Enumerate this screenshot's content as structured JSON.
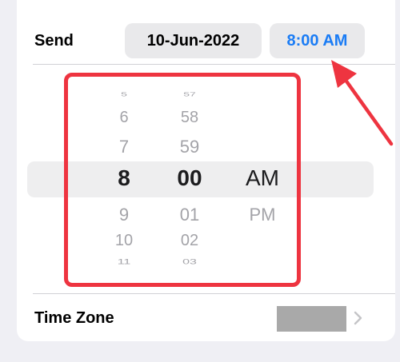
{
  "send": {
    "label": "Send",
    "date": "10-Jun-2022",
    "time": "8:00 AM"
  },
  "picker": {
    "hours": [
      "5",
      "6",
      "7",
      "8",
      "9",
      "10",
      "11"
    ],
    "minutes": [
      "57",
      "58",
      "59",
      "00",
      "01",
      "02",
      "03"
    ],
    "periods": [
      "AM",
      "PM"
    ],
    "selected_hour": "8",
    "selected_minute": "00",
    "selected_period": "AM"
  },
  "time_zone": {
    "label": "Time Zone",
    "chevron_icon": "chevron-right-icon"
  },
  "colors": {
    "accent_blue": "#1a7cf5",
    "highlight_red": "#ee3440"
  }
}
